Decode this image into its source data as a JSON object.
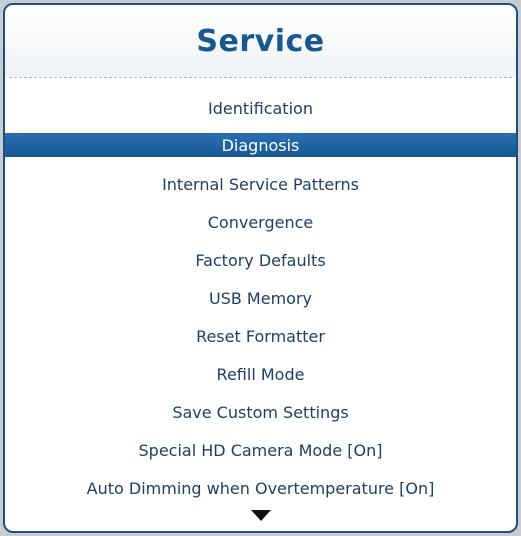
{
  "menu": {
    "title": "Service",
    "items": [
      {
        "label": "Identification",
        "selected": false
      },
      {
        "label": "Diagnosis",
        "selected": true
      },
      {
        "label": "Internal Service Patterns",
        "selected": false
      },
      {
        "label": "Convergence",
        "selected": false
      },
      {
        "label": "Factory Defaults",
        "selected": false
      },
      {
        "label": "USB Memory",
        "selected": false
      },
      {
        "label": "Reset Formatter",
        "selected": false
      },
      {
        "label": "Refill Mode",
        "selected": false
      },
      {
        "label": "Save Custom Settings",
        "selected": false
      },
      {
        "label": "Special HD Camera Mode [On]",
        "selected": false
      },
      {
        "label": "Auto Dimming when Overtemperature [On]",
        "selected": false
      }
    ],
    "scroll_indicator_icon": "scroll-down-arrow-icon"
  },
  "colors": {
    "title": "#16588f",
    "selection": "#1d5f9c",
    "item_text": "#1e3f66"
  }
}
